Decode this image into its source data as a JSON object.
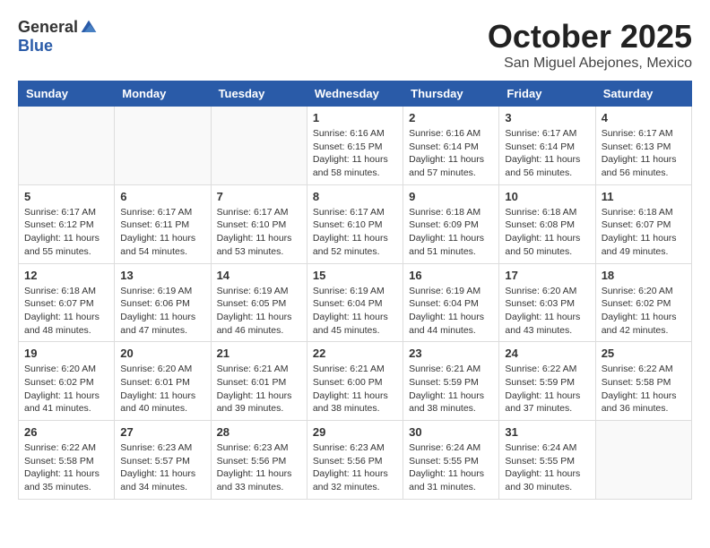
{
  "header": {
    "logo_general": "General",
    "logo_blue": "Blue",
    "month_title": "October 2025",
    "location": "San Miguel Abejones, Mexico"
  },
  "days_of_week": [
    "Sunday",
    "Monday",
    "Tuesday",
    "Wednesday",
    "Thursday",
    "Friday",
    "Saturday"
  ],
  "weeks": [
    [
      {
        "day": "",
        "info": ""
      },
      {
        "day": "",
        "info": ""
      },
      {
        "day": "",
        "info": ""
      },
      {
        "day": "1",
        "info": "Sunrise: 6:16 AM\nSunset: 6:15 PM\nDaylight: 11 hours\nand 58 minutes."
      },
      {
        "day": "2",
        "info": "Sunrise: 6:16 AM\nSunset: 6:14 PM\nDaylight: 11 hours\nand 57 minutes."
      },
      {
        "day": "3",
        "info": "Sunrise: 6:17 AM\nSunset: 6:14 PM\nDaylight: 11 hours\nand 56 minutes."
      },
      {
        "day": "4",
        "info": "Sunrise: 6:17 AM\nSunset: 6:13 PM\nDaylight: 11 hours\nand 56 minutes."
      }
    ],
    [
      {
        "day": "5",
        "info": "Sunrise: 6:17 AM\nSunset: 6:12 PM\nDaylight: 11 hours\nand 55 minutes."
      },
      {
        "day": "6",
        "info": "Sunrise: 6:17 AM\nSunset: 6:11 PM\nDaylight: 11 hours\nand 54 minutes."
      },
      {
        "day": "7",
        "info": "Sunrise: 6:17 AM\nSunset: 6:10 PM\nDaylight: 11 hours\nand 53 minutes."
      },
      {
        "day": "8",
        "info": "Sunrise: 6:17 AM\nSunset: 6:10 PM\nDaylight: 11 hours\nand 52 minutes."
      },
      {
        "day": "9",
        "info": "Sunrise: 6:18 AM\nSunset: 6:09 PM\nDaylight: 11 hours\nand 51 minutes."
      },
      {
        "day": "10",
        "info": "Sunrise: 6:18 AM\nSunset: 6:08 PM\nDaylight: 11 hours\nand 50 minutes."
      },
      {
        "day": "11",
        "info": "Sunrise: 6:18 AM\nSunset: 6:07 PM\nDaylight: 11 hours\nand 49 minutes."
      }
    ],
    [
      {
        "day": "12",
        "info": "Sunrise: 6:18 AM\nSunset: 6:07 PM\nDaylight: 11 hours\nand 48 minutes."
      },
      {
        "day": "13",
        "info": "Sunrise: 6:19 AM\nSunset: 6:06 PM\nDaylight: 11 hours\nand 47 minutes."
      },
      {
        "day": "14",
        "info": "Sunrise: 6:19 AM\nSunset: 6:05 PM\nDaylight: 11 hours\nand 46 minutes."
      },
      {
        "day": "15",
        "info": "Sunrise: 6:19 AM\nSunset: 6:04 PM\nDaylight: 11 hours\nand 45 minutes."
      },
      {
        "day": "16",
        "info": "Sunrise: 6:19 AM\nSunset: 6:04 PM\nDaylight: 11 hours\nand 44 minutes."
      },
      {
        "day": "17",
        "info": "Sunrise: 6:20 AM\nSunset: 6:03 PM\nDaylight: 11 hours\nand 43 minutes."
      },
      {
        "day": "18",
        "info": "Sunrise: 6:20 AM\nSunset: 6:02 PM\nDaylight: 11 hours\nand 42 minutes."
      }
    ],
    [
      {
        "day": "19",
        "info": "Sunrise: 6:20 AM\nSunset: 6:02 PM\nDaylight: 11 hours\nand 41 minutes."
      },
      {
        "day": "20",
        "info": "Sunrise: 6:20 AM\nSunset: 6:01 PM\nDaylight: 11 hours\nand 40 minutes."
      },
      {
        "day": "21",
        "info": "Sunrise: 6:21 AM\nSunset: 6:01 PM\nDaylight: 11 hours\nand 39 minutes."
      },
      {
        "day": "22",
        "info": "Sunrise: 6:21 AM\nSunset: 6:00 PM\nDaylight: 11 hours\nand 38 minutes."
      },
      {
        "day": "23",
        "info": "Sunrise: 6:21 AM\nSunset: 5:59 PM\nDaylight: 11 hours\nand 38 minutes."
      },
      {
        "day": "24",
        "info": "Sunrise: 6:22 AM\nSunset: 5:59 PM\nDaylight: 11 hours\nand 37 minutes."
      },
      {
        "day": "25",
        "info": "Sunrise: 6:22 AM\nSunset: 5:58 PM\nDaylight: 11 hours\nand 36 minutes."
      }
    ],
    [
      {
        "day": "26",
        "info": "Sunrise: 6:22 AM\nSunset: 5:58 PM\nDaylight: 11 hours\nand 35 minutes."
      },
      {
        "day": "27",
        "info": "Sunrise: 6:23 AM\nSunset: 5:57 PM\nDaylight: 11 hours\nand 34 minutes."
      },
      {
        "day": "28",
        "info": "Sunrise: 6:23 AM\nSunset: 5:56 PM\nDaylight: 11 hours\nand 33 minutes."
      },
      {
        "day": "29",
        "info": "Sunrise: 6:23 AM\nSunset: 5:56 PM\nDaylight: 11 hours\nand 32 minutes."
      },
      {
        "day": "30",
        "info": "Sunrise: 6:24 AM\nSunset: 5:55 PM\nDaylight: 11 hours\nand 31 minutes."
      },
      {
        "day": "31",
        "info": "Sunrise: 6:24 AM\nSunset: 5:55 PM\nDaylight: 11 hours\nand 30 minutes."
      },
      {
        "day": "",
        "info": ""
      }
    ]
  ]
}
